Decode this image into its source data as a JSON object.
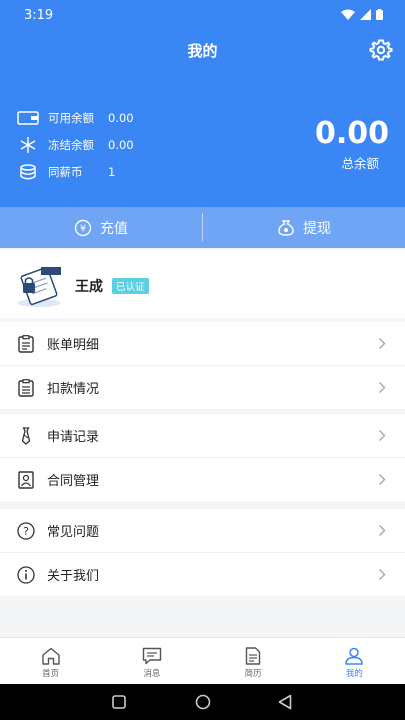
{
  "status_bar": {
    "time": "3:19"
  },
  "header": {
    "title": "我的"
  },
  "balances": [
    {
      "label": "可用余额",
      "value": "0.00",
      "icon": "wallet-icon"
    },
    {
      "label": "冻结余额",
      "value": "0.00",
      "icon": "snowflake-icon"
    },
    {
      "label": "同薪币",
      "value": "1",
      "icon": "coin-stack-icon"
    }
  ],
  "total": {
    "amount": "0.00",
    "label": "总余额"
  },
  "actions": {
    "recharge": "充值",
    "withdraw": "提现"
  },
  "user": {
    "name": "王成",
    "badge": "已认证"
  },
  "menu": [
    {
      "label": "账单明细",
      "icon": "bill-icon"
    },
    {
      "label": "扣款情况",
      "icon": "deduction-icon"
    },
    {
      "label": "申请记录",
      "icon": "tie-icon"
    },
    {
      "label": "合同管理",
      "icon": "contract-icon"
    },
    {
      "label": "常见问题",
      "icon": "question-icon"
    },
    {
      "label": "关于我们",
      "icon": "info-icon"
    }
  ],
  "tabs": [
    {
      "label": "首页",
      "icon": "home-icon"
    },
    {
      "label": "消息",
      "icon": "message-icon"
    },
    {
      "label": "简历",
      "icon": "resume-icon"
    },
    {
      "label": "我的",
      "icon": "profile-icon",
      "active": true
    }
  ],
  "colors": {
    "primary": "#3a86f5",
    "action_bar": "#6fa5f4",
    "badge": "#5ccfe3"
  }
}
